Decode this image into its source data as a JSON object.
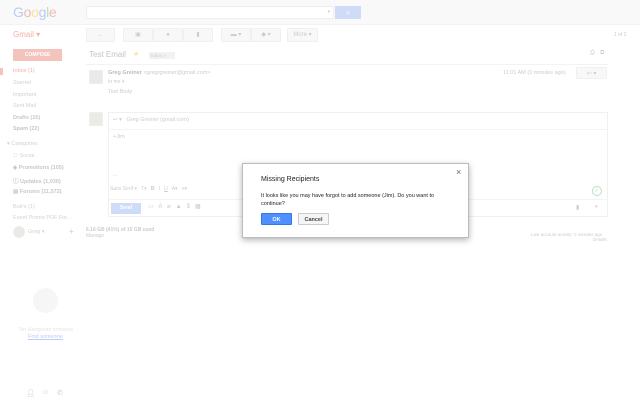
{
  "header": {
    "logo": "Google",
    "search_button_icon": "search-icon"
  },
  "toolbar": {
    "back_icon": "back-arrow-icon",
    "archive_icon": "archive-icon",
    "spam_icon": "report-spam-icon",
    "delete_icon": "trash-icon",
    "move_icon": "folder-icon",
    "label_icon": "label-icon",
    "more_label": "More",
    "pagination": "1 of 2"
  },
  "sidebar": {
    "app_label": "Gmail",
    "compose": "COMPOSE",
    "items": [
      {
        "label": "Inbox (1)"
      },
      {
        "label": "Starred"
      },
      {
        "label": "Important"
      },
      {
        "label": "Sent Mail"
      },
      {
        "label": "Drafts (15)"
      },
      {
        "label": "Spam (22)"
      },
      {
        "label": "Categories"
      },
      {
        "label": "Social"
      },
      {
        "label": "Promotions (105)"
      },
      {
        "label": "Updates (1,030)"
      },
      {
        "label": "Forums (11,572)"
      },
      {
        "label": "Bob's (1)"
      },
      {
        "label": "Event Promo PDF For..."
      }
    ],
    "user": "Greg",
    "hangouts_empty": "No Hangouts contacts",
    "find_someone": "Find someone"
  },
  "thread": {
    "subject": "Test Email",
    "label": "Inbox",
    "sender_name": "Greg Greiner",
    "sender_email": "<gregrgreiner@gmail.com>",
    "to": "to me",
    "body": "Test Body",
    "time": "11:01 AM (0 minutes ago)"
  },
  "reply": {
    "from": "Greg Greiner (gmail.com)",
    "body": "+Jim",
    "ellipsis": "...",
    "font": "Sans Serif",
    "send": "Send"
  },
  "footer": {
    "storage": "6.16 GB (41%) of 15 GB used",
    "manage": "Manage",
    "activity": "Last account activity: 0 minutes ago",
    "details": "Details"
  },
  "dialog": {
    "title": "Missing Recipients",
    "message": "It looks like you may have forgot to add someone (Jim). Do you want to continue?",
    "ok": "OK",
    "cancel": "Cancel",
    "accent": "#4d90fe"
  }
}
